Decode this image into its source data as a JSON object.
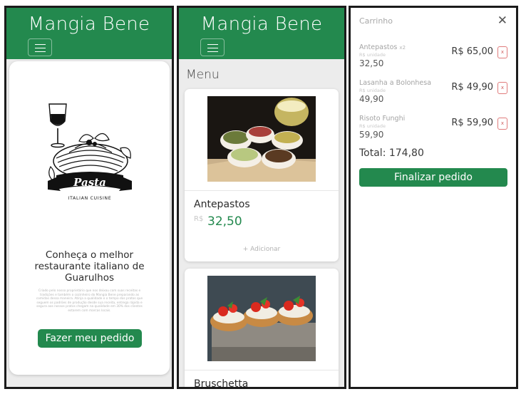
{
  "brand": "Mangia Bene",
  "colors": {
    "primary": "#23894e",
    "danger": "#e07b7b"
  },
  "home": {
    "logo_text": "Pasta",
    "logo_subtext": "ITALIAN CUISINE",
    "title": "Conheça o melhor restaurante italiano de Guarulhos",
    "description": "Criado pelo nosso proprietário que nos deixou com suas receitas e tradições e também o cozinheiro do Mangia Bene preparando as comidas dessa maneira. Atinja a qualidade e o tempo dos pratos que seguem os padrões de produção desde sua receita, entrega rápida e segura aos nossos pratos chegam na qualidade em 30% dos clientes estarem com marcas locais.",
    "cta": "Fazer meu pedido"
  },
  "menu": {
    "title": "Menu",
    "currency": "R$",
    "add_label": "+ Adicionar",
    "items": [
      {
        "name": "Antepastos",
        "price": "32,50"
      },
      {
        "name": "Bruschetta"
      }
    ]
  },
  "cart": {
    "title": "Carrinho",
    "close_icon": "close-icon",
    "unit_label": "R$ unidade",
    "remove_label": "x",
    "items": [
      {
        "name": "Antepastos",
        "qty": "x2",
        "unit_price": "32,50",
        "total": "R$ 65,00"
      },
      {
        "name": "Lasanha a Bolonhesa",
        "unit_price": "49,90",
        "total": "R$ 49,90"
      },
      {
        "name": "Risoto Funghi",
        "unit_price": "59,90",
        "total": "R$ 59,90"
      }
    ],
    "total_label": "Total: 174,80",
    "checkout": "Finalizar pedido"
  }
}
